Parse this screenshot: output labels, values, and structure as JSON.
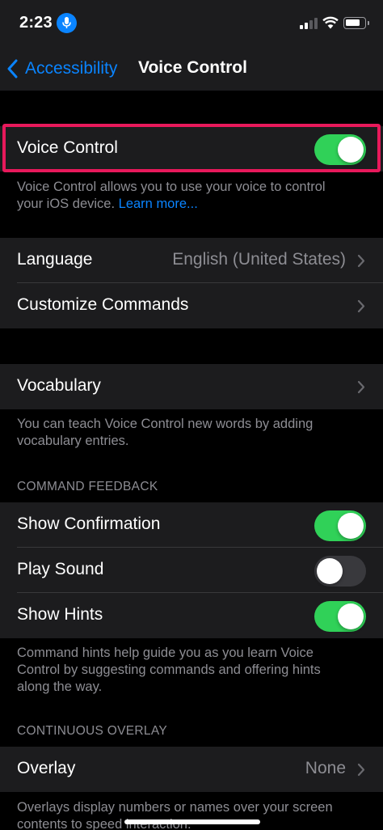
{
  "status_bar": {
    "time": "2:23",
    "mic_icon": "microphone-icon",
    "signal_icon": "cellular-signal-icon",
    "wifi_icon": "wifi-icon",
    "battery_icon": "battery-icon",
    "battery_level": 0.8
  },
  "nav": {
    "back_label": "Accessibility",
    "back_icon": "chevron-left-icon",
    "title": "Voice Control"
  },
  "voice_control": {
    "label": "Voice Control",
    "enabled": true,
    "footer_text": "Voice Control allows you to use your voice to control your iOS device.",
    "footer_link": "Learn more..."
  },
  "language_group": {
    "language_label": "Language",
    "language_value": "English (United States)",
    "customize_label": "Customize Commands"
  },
  "vocabulary_group": {
    "vocabulary_label": "Vocabulary",
    "footer_text": "You can teach Voice Control new words by adding vocabulary entries."
  },
  "command_feedback": {
    "header": "COMMAND FEEDBACK",
    "show_confirmation_label": "Show Confirmation",
    "show_confirmation_on": true,
    "play_sound_label": "Play Sound",
    "play_sound_on": false,
    "show_hints_label": "Show Hints",
    "show_hints_on": true,
    "footer_text": "Command hints help guide you as you learn Voice Control by suggesting commands and offering hints along the way."
  },
  "continuous_overlay": {
    "header": "CONTINUOUS OVERLAY",
    "overlay_label": "Overlay",
    "overlay_value": "None",
    "footer_text": "Overlays display numbers or names over your screen contents to speed interaction."
  },
  "colors": {
    "accent": "#0a84ff",
    "toggle_on": "#30d158",
    "highlight": "#e8195b",
    "background": "#000000",
    "cell": "#1c1c1e"
  }
}
